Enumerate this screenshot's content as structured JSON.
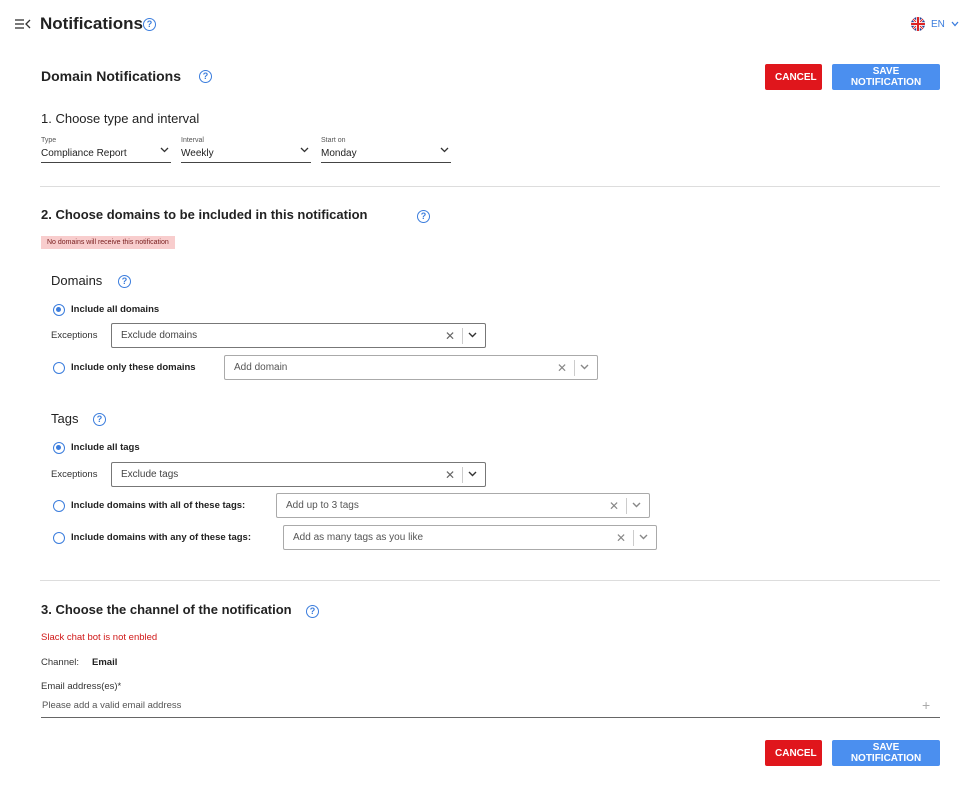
{
  "header": {
    "title": "Notifications",
    "language": "EN"
  },
  "panel": {
    "title": "Domain Notifications",
    "cancel_label": "CANCEL",
    "save_label": "SAVE NOTIFICATION"
  },
  "step1": {
    "title": "1. Choose type and interval",
    "type": {
      "label": "Type",
      "value": "Compliance Report"
    },
    "interval": {
      "label": "Interval",
      "value": "Weekly"
    },
    "start": {
      "label": "Start on",
      "value": "Monday"
    }
  },
  "step2": {
    "title": "2. Choose domains to be included in this notification",
    "warning": "No domains will receive this notification",
    "domains": {
      "title": "Domains",
      "include_all_label": "Include all domains",
      "include_all_checked": true,
      "exceptions_label": "Exceptions",
      "exceptions_placeholder": "Exclude domains",
      "include_only_label": "Include only these domains",
      "include_only_placeholder": "Add domain"
    },
    "tags": {
      "title": "Tags",
      "include_all_label": "Include all tags",
      "include_all_checked": true,
      "exceptions_label": "Exceptions",
      "exceptions_placeholder": "Exclude tags",
      "all_tags_label": "Include domains with all of these tags:",
      "all_tags_placeholder": "Add up to 3 tags",
      "any_tags_label": "Include domains with any of these tags:",
      "any_tags_placeholder": "Add as many tags as you like"
    }
  },
  "step3": {
    "title": "3. Choose the channel of the notification",
    "slack_warning": "Slack chat bot is not enbled",
    "channel_label": "Channel:",
    "channel_value": "Email",
    "email_label": "Email address(es)*",
    "email_placeholder": "Please add a valid email address"
  },
  "colors": {
    "accent": "#3b7ddd",
    "cancel": "#e0161c",
    "save": "#4b8fef",
    "warning_bg": "#f8cdcd"
  }
}
